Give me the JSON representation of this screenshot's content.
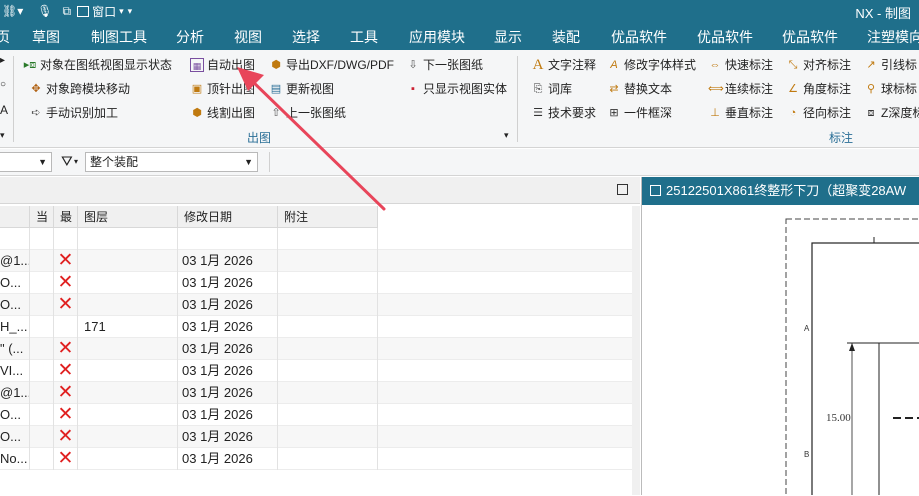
{
  "titlebar": {
    "window_menu": "窗口",
    "app_title": "NX - 制图"
  },
  "tabs": [
    "草图",
    "制图工具",
    "分析",
    "视图",
    "选择",
    "工具",
    "应用模块",
    "显示",
    "装配",
    "优品软件",
    "优品软件",
    "优品软件",
    "注塑模向"
  ],
  "ribbon": {
    "col1": [
      "对象在图纸视图显示状态",
      "对象跨模块移动",
      "手动识别加工"
    ],
    "col2": [
      "自动出图",
      "顶针出图",
      "线割出图"
    ],
    "col3": [
      "导出DXF/DWG/PDF",
      "更新视图",
      "上一张图纸"
    ],
    "col4": [
      "下一张图纸",
      "只显示视图实体"
    ],
    "group_output": "出图",
    "col5": [
      "文字注释",
      "词库",
      "技术要求"
    ],
    "col6": [
      "修改字体样式",
      "替换文本",
      "一件框深"
    ],
    "col7": [
      "快速标注",
      "连续标注",
      "垂直标注"
    ],
    "col8": [
      "对齐标注",
      "角度标注",
      "径向标注"
    ],
    "col9": [
      "引线标",
      "球标标",
      "Z深度标"
    ],
    "group_dims": "标注"
  },
  "filter": {
    "assembly_scope": "整个装配"
  },
  "nav": {
    "headers": [
      "当",
      "最",
      "图层",
      "修改日期",
      "附注"
    ],
    "rows": [
      {
        "name": "",
        "x": false,
        "layer": "",
        "date": ""
      },
      {
        "name": "@1...",
        "x": true,
        "layer": "",
        "date": "03 1月 2026"
      },
      {
        "name": "O...",
        "x": true,
        "layer": "",
        "date": "03 1月 2026"
      },
      {
        "name": "O...",
        "x": true,
        "layer": "",
        "date": "03 1月 2026"
      },
      {
        "name": "H_...",
        "x": false,
        "layer": "171",
        "date": "03 1月 2026"
      },
      {
        "name": "\" (...",
        "x": true,
        "layer": "",
        "date": "03 1月 2026"
      },
      {
        "name": "VI...",
        "x": true,
        "layer": "",
        "date": "03 1月 2026"
      },
      {
        "name": "@1...",
        "x": true,
        "layer": "",
        "date": "03 1月 2026"
      },
      {
        "name": "O...",
        "x": true,
        "layer": "",
        "date": "03 1月 2026"
      },
      {
        "name": "O...",
        "x": true,
        "layer": "",
        "date": "03 1月 2026"
      },
      {
        "name": "No...",
        "x": true,
        "layer": "",
        "date": "03 1月 2026"
      }
    ]
  },
  "drawing": {
    "tab_title": "25122501X861终整形下刀（超聚变28AW",
    "dimension": "15.00",
    "zone_a": "A",
    "zone_b": "B"
  },
  "colors": {
    "accent": "#1f6f8b",
    "arrow": "#e8455a",
    "x_mark": "#e02020"
  }
}
